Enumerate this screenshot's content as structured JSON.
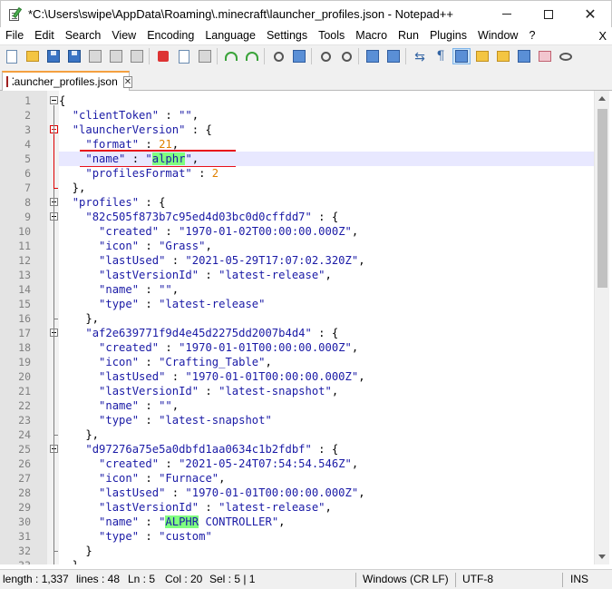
{
  "window": {
    "title": "*C:\\Users\\swipe\\AppData\\Roaming\\.minecraft\\launcher_profiles.json - Notepad++",
    "minimize": "—",
    "maximize": "",
    "close": "✕"
  },
  "menu": {
    "items": [
      "File",
      "Edit",
      "Search",
      "View",
      "Encoding",
      "Language",
      "Settings",
      "Tools",
      "Macro",
      "Run",
      "Plugins",
      "Window",
      "?"
    ],
    "close": "X"
  },
  "tab": {
    "label": "launcher_profiles.json",
    "close": "✕"
  },
  "editor": {
    "current_line": 5,
    "lines": [
      {
        "n": "1",
        "text": "{"
      },
      {
        "n": "2",
        "text": "  \"clientToken\" : \"\","
      },
      {
        "n": "3",
        "text": "  \"launcherVersion\" : {"
      },
      {
        "n": "4",
        "text": "    \"format\" : 21,"
      },
      {
        "n": "5",
        "text": "    \"name\" : \"alphr\","
      },
      {
        "n": "6",
        "text": "    \"profilesFormat\" : 2"
      },
      {
        "n": "7",
        "text": "  },"
      },
      {
        "n": "8",
        "text": "  \"profiles\" : {"
      },
      {
        "n": "9",
        "text": "    \"82c505f873b7c95ed4d03bc0d0cffdd7\" : {"
      },
      {
        "n": "10",
        "text": "      \"created\" : \"1970-01-02T00:00:00.000Z\","
      },
      {
        "n": "11",
        "text": "      \"icon\" : \"Grass\","
      },
      {
        "n": "12",
        "text": "      \"lastUsed\" : \"2021-05-29T17:07:02.320Z\","
      },
      {
        "n": "13",
        "text": "      \"lastVersionId\" : \"latest-release\","
      },
      {
        "n": "14",
        "text": "      \"name\" : \"\","
      },
      {
        "n": "15",
        "text": "      \"type\" : \"latest-release\""
      },
      {
        "n": "16",
        "text": "    },"
      },
      {
        "n": "17",
        "text": "    \"af2e639771f9d4e45d2275dd2007b4d4\" : {"
      },
      {
        "n": "18",
        "text": "      \"created\" : \"1970-01-01T00:00:00.000Z\","
      },
      {
        "n": "19",
        "text": "      \"icon\" : \"Crafting_Table\","
      },
      {
        "n": "20",
        "text": "      \"lastUsed\" : \"1970-01-01T00:00:00.000Z\","
      },
      {
        "n": "21",
        "text": "      \"lastVersionId\" : \"latest-snapshot\","
      },
      {
        "n": "22",
        "text": "      \"name\" : \"\","
      },
      {
        "n": "23",
        "text": "      \"type\" : \"latest-snapshot\""
      },
      {
        "n": "24",
        "text": "    },"
      },
      {
        "n": "25",
        "text": "    \"d97276a75e5a0dbfd1aa0634c1b2fdbf\" : {"
      },
      {
        "n": "26",
        "text": "      \"created\" : \"2021-05-24T07:54:54.546Z\","
      },
      {
        "n": "27",
        "text": "      \"icon\" : \"Furnace\","
      },
      {
        "n": "28",
        "text": "      \"lastUsed\" : \"1970-01-01T00:00:00.000Z\","
      },
      {
        "n": "29",
        "text": "      \"lastVersionId\" : \"latest-release\","
      },
      {
        "n": "30",
        "text": "      \"name\" : \"ALPHR CONTROLLER\","
      },
      {
        "n": "31",
        "text": "      \"type\" : \"custom\""
      },
      {
        "n": "32",
        "text": "    }"
      },
      {
        "n": "33",
        "text": "  }"
      }
    ],
    "highlighted_words": [
      "alphr",
      "ALPHR"
    ]
  },
  "status": {
    "length": "length : 1,337",
    "lines": "lines : 48",
    "ln": "Ln : 5",
    "col": "Col : 20",
    "sel": "Sel : 5 | 1",
    "eol": "Windows (CR LF)",
    "encoding": "UTF-8",
    "mode": "INS"
  },
  "colors": {
    "accent_tab": "#f4a040",
    "highlight": "#80ff80",
    "annotation_box": "#e8101a",
    "number": "#e08000",
    "key": "#1a1aa6"
  }
}
